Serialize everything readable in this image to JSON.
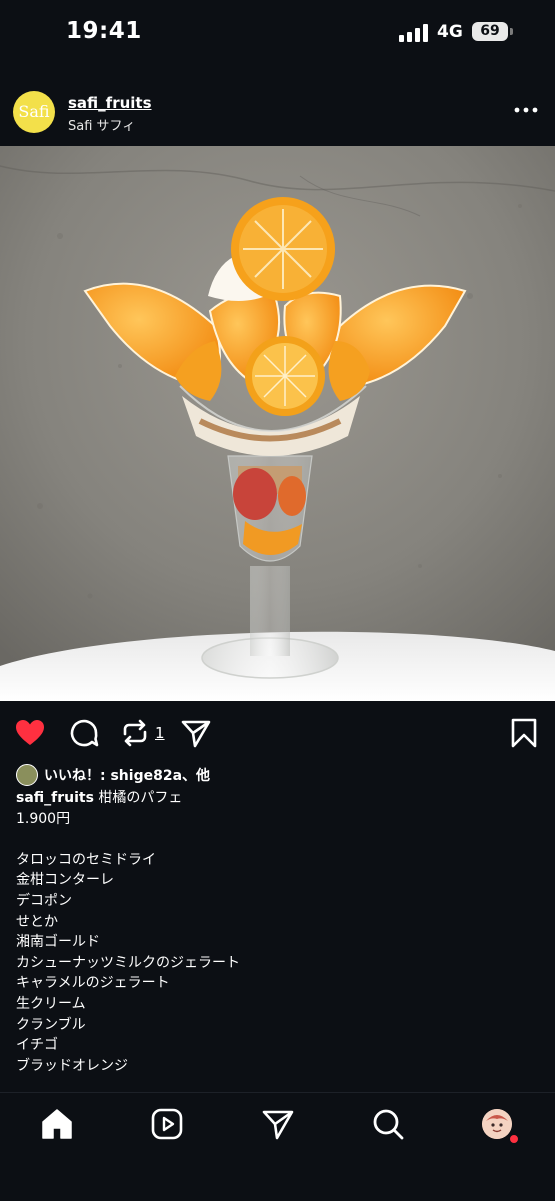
{
  "status_bar": {
    "time": "19:41",
    "network": "4G",
    "battery": "69"
  },
  "post": {
    "username": "safi_fruits",
    "subtitle": "Safi サフィ",
    "avatar_text": "Safi",
    "liked": true,
    "repost_count": "1",
    "likes_text": "いいね！: shige82a、他",
    "caption": {
      "username": "safi_fruits",
      "title": "柑橘のパフェ",
      "price": "1.900円",
      "ingredients": [
        "タロッコのセミドライ",
        "金柑コンターレ",
        "デコポン",
        "せとか",
        "湘南ゴールド",
        "カシューナッツミルクのジェラート",
        "キャラメルのジェラート",
        "生クリーム",
        "クランブル",
        "イチゴ",
        "ブラッドオレンジ"
      ]
    }
  },
  "icons": {
    "like": "heart-icon",
    "comment": "comment-icon",
    "repost": "repost-icon",
    "share": "send-icon",
    "save": "bookmark-icon",
    "nav": [
      "home-icon",
      "reels-icon",
      "send-icon",
      "search-icon",
      "profile-avatar"
    ]
  },
  "colors": {
    "background": "#0c0f14",
    "like": "#ff3040",
    "avatar": "#f3e04a"
  }
}
